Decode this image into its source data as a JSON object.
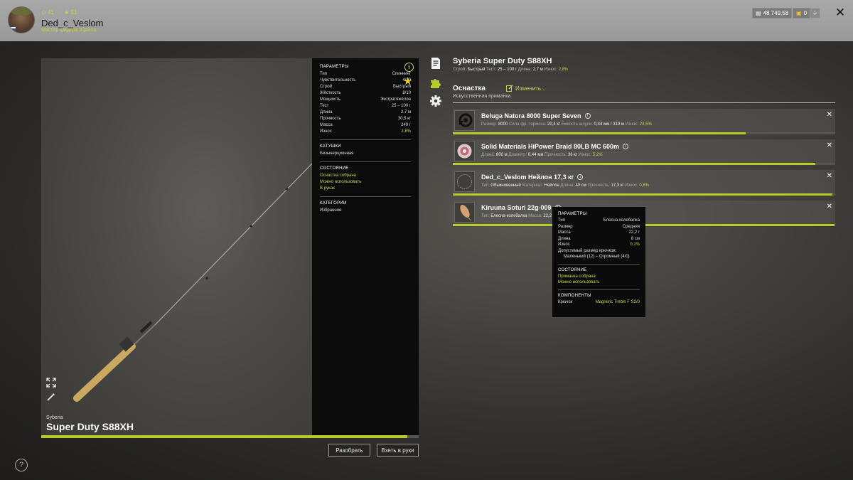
{
  "player": {
    "stat_level": "41",
    "stat_rank": "51",
    "username": "Ded_c_Veslom",
    "rank_title": "Мастер фидера 3 ранга"
  },
  "currency": {
    "silver": "48 749,58",
    "gold": "0"
  },
  "rod": {
    "brand": "Syberia",
    "model": "Super Duty S88XH",
    "durability_progress": 0.97
  },
  "params": {
    "title": "ПАРАМЕТРЫ",
    "rows": [
      {
        "label": "Тип",
        "value": "Спиннинг"
      },
      {
        "label": "Чувствительность",
        "value": "4/10"
      },
      {
        "label": "Строй",
        "value": "Быстрый"
      },
      {
        "label": "Жёсткость",
        "value": "8/10"
      },
      {
        "label": "Мощность",
        "value": "Экстратяжёлое"
      },
      {
        "label": "Тест",
        "value": "25 – 100 г"
      },
      {
        "label": "Длина",
        "value": "2,7 м"
      },
      {
        "label": "Прочность",
        "value": "30,5 кг"
      },
      {
        "label": "Масса",
        "value": "249 г"
      },
      {
        "label": "Износ",
        "value": "2,8%"
      }
    ],
    "reels_title": "КАТУШКИ",
    "reels_value": "Безынерционная",
    "state_title": "СОСТОЯНИЕ",
    "state_lines": [
      "Оснастка собрана",
      "Можно использовать",
      "В руках"
    ],
    "category_title": "КАТЕГОРИИ",
    "category_value": "Избранное"
  },
  "buttons": {
    "disassemble": "Разобрать",
    "take": "Взять в руки"
  },
  "header": {
    "title": "Syberia Super Duty S88XH",
    "sub": [
      {
        "label": "Строй:",
        "value": "Быстрый"
      },
      {
        "label": "Тест:",
        "value": "25 – 100 г"
      },
      {
        "label": "Длина:",
        "value": "2,7 м"
      },
      {
        "label": "Износ:",
        "value": "2,8%"
      }
    ],
    "tackle_title": "Оснастка",
    "edit_label": "Изменить...",
    "tackle_sub": "Искусственная приманка"
  },
  "slots": [
    {
      "name": "Beluga Natora 8000 Super Seven",
      "sub": [
        {
          "label": "Размер:",
          "value": "8000"
        },
        {
          "label": "Сила фр. тормоза:",
          "value": "20,4 кг"
        },
        {
          "label": "Ёмкость шпули:",
          "value": "0,44 мм / 319 м"
        },
        {
          "label": "Износ:",
          "value": "23,5%"
        }
      ],
      "progress": 0.765
    },
    {
      "name": "Solid Materials HiPower Braid 80LB MC 600m",
      "sub": [
        {
          "label": "Длина:",
          "value": "600 м"
        },
        {
          "label": "Диаметр:",
          "value": "0,44 мм"
        },
        {
          "label": "Прочность:",
          "value": "36 кг"
        },
        {
          "label": "Износ:",
          "value": "5,2%"
        }
      ],
      "progress": 0.948
    },
    {
      "name": "Ded_c_Veslom Нейлон 17,3 кг",
      "sub": [
        {
          "label": "Тип:",
          "value": "Обыкновенный"
        },
        {
          "label": "Материал:",
          "value": "Нейлон"
        },
        {
          "label": "Длина:",
          "value": "40 см"
        },
        {
          "label": "Прочность:",
          "value": "17,3 кг"
        },
        {
          "label": "Износ:",
          "value": "0,8%"
        }
      ],
      "progress": 0.992
    },
    {
      "name": "Kiruuna Soturi 22g-009",
      "sub": [
        {
          "label": "Тип:",
          "value": "Блесна-колебалка"
        },
        {
          "label": "Масса:",
          "value": "22,2"
        }
      ],
      "progress": 0.999
    }
  ],
  "tooltip": {
    "title": "ПАРАМЕТРЫ",
    "rows": [
      {
        "label": "Тип",
        "value": "Блесна-колебалка"
      },
      {
        "label": "Размер",
        "value": "Средняя"
      },
      {
        "label": "Масса",
        "value": "22,2 г"
      },
      {
        "label": "Длина",
        "value": "8 см"
      },
      {
        "label": "Износ",
        "value": "0,1%"
      }
    ],
    "hook_size_label": "Допустимый размер крючков:",
    "hook_size_value": "Маленький (12) – Огромный (4/0)",
    "state_title": "СОСТОЯНИЕ",
    "state_lines": [
      "Приманка собрана",
      "Можно использовать"
    ],
    "components_title": "КОМПОНЕНТЫ",
    "component_label": "Крючок",
    "component_value": "Magneric Treble F S2/0"
  },
  "help_label": "?"
}
